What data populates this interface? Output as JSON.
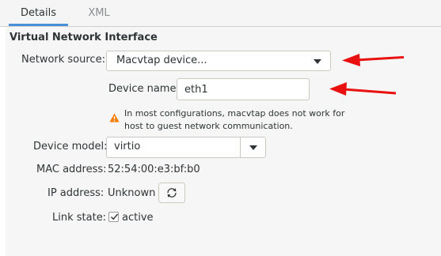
{
  "tabs": [
    {
      "label": "Details"
    },
    {
      "label": "XML"
    }
  ],
  "section_title": "Virtual Network Interface",
  "network_source": {
    "label": "Network source:",
    "value": "Macvtap device..."
  },
  "device_name": {
    "label": "Device name:",
    "value": "eth1"
  },
  "warning": {
    "line1": "In most configurations, macvtap does not work for",
    "line2": "host to guest network communication."
  },
  "device_model": {
    "label": "Device model:",
    "value": "virtio"
  },
  "mac_address": {
    "label": "MAC address:",
    "value": "52:54:00:e3:bf:b0"
  },
  "ip_address": {
    "label": "IP address:",
    "value": "Unknown"
  },
  "link_state": {
    "label": "Link state:",
    "checkbox_label": "active",
    "checked": true
  },
  "annotation_color": "#e8110f",
  "icons": [
    "warning-icon",
    "refresh-icon",
    "chevron-down-icon",
    "checkmark-icon",
    "arrow-left-icon"
  ]
}
